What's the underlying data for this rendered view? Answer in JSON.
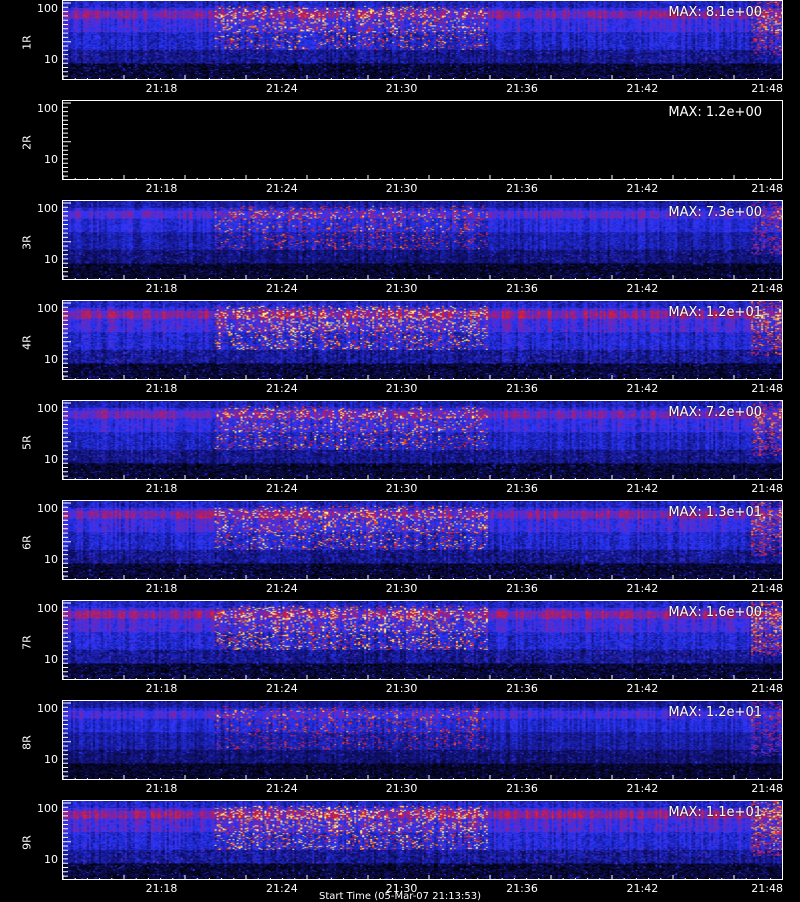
{
  "chart_data": {
    "type": "heatmap",
    "x_ticks": [
      "21:18",
      "21:24",
      "21:30",
      "21:36",
      "21:42",
      "21:48"
    ],
    "y_ticks": [
      "100",
      "10"
    ],
    "y_scale": "log",
    "colormap": [
      "#000000",
      "#1a1aa0",
      "#2e3fff",
      "#c0206a",
      "#ff2a00",
      "#ffd24a"
    ],
    "panels": [
      {
        "label": "1R",
        "max": "MAX: 8.1e+00",
        "intensity": 1.0
      },
      {
        "label": "2R",
        "max": "MAX: 1.2e+00",
        "intensity": 0.0
      },
      {
        "label": "3R",
        "max": "MAX: 7.3e+00",
        "intensity": 0.85
      },
      {
        "label": "4R",
        "max": "MAX: 1.2e+01",
        "intensity": 1.1
      },
      {
        "label": "5R",
        "max": "MAX: 7.2e+00",
        "intensity": 0.95
      },
      {
        "label": "6R",
        "max": "MAX: 1.3e+01",
        "intensity": 1.0
      },
      {
        "label": "7R",
        "max": "MAX: 1.6e+00",
        "intensity": 1.15
      },
      {
        "label": "8R",
        "max": "MAX: 1.2e+01",
        "intensity": 0.8
      },
      {
        "label": "9R",
        "max": "MAX: 1.1e+01",
        "intensity": 1.2
      }
    ]
  },
  "footer": "Start Time (05-Mar-07 21:13:53)"
}
